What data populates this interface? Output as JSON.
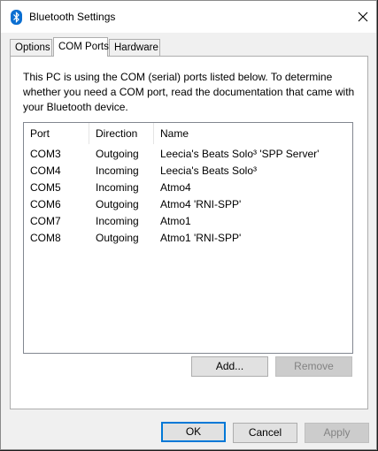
{
  "window": {
    "title": "Bluetooth Settings",
    "icon": "bluetooth-icon",
    "close_icon": "close-icon"
  },
  "tabs": [
    {
      "label": "Options",
      "active": false
    },
    {
      "label": "COM Ports",
      "active": true
    },
    {
      "label": "Hardware",
      "active": false
    }
  ],
  "description": "This PC is using the COM (serial) ports listed below. To determine whether you need a COM port, read the documentation that came with your Bluetooth device.",
  "ports_list": {
    "columns": [
      "Port",
      "Direction",
      "Name"
    ],
    "rows": [
      {
        "port": "COM3",
        "direction": "Outgoing",
        "name": "Leecia's Beats Solo³ 'SPP Server'"
      },
      {
        "port": "COM4",
        "direction": "Incoming",
        "name": "Leecia's Beats Solo³"
      },
      {
        "port": "COM5",
        "direction": "Incoming",
        "name": "Atmo4"
      },
      {
        "port": "COM6",
        "direction": "Outgoing",
        "name": "Atmo4 'RNI-SPP'"
      },
      {
        "port": "COM7",
        "direction": "Incoming",
        "name": "Atmo1"
      },
      {
        "port": "COM8",
        "direction": "Outgoing",
        "name": "Atmo1 'RNI-SPP'"
      }
    ]
  },
  "list_buttons": {
    "add": "Add...",
    "remove": "Remove"
  },
  "dialog_buttons": {
    "ok": "OK",
    "cancel": "Cancel",
    "apply": "Apply"
  },
  "colors": {
    "accent": "#0078d7",
    "bluetooth_icon": "#0a6ed1"
  }
}
